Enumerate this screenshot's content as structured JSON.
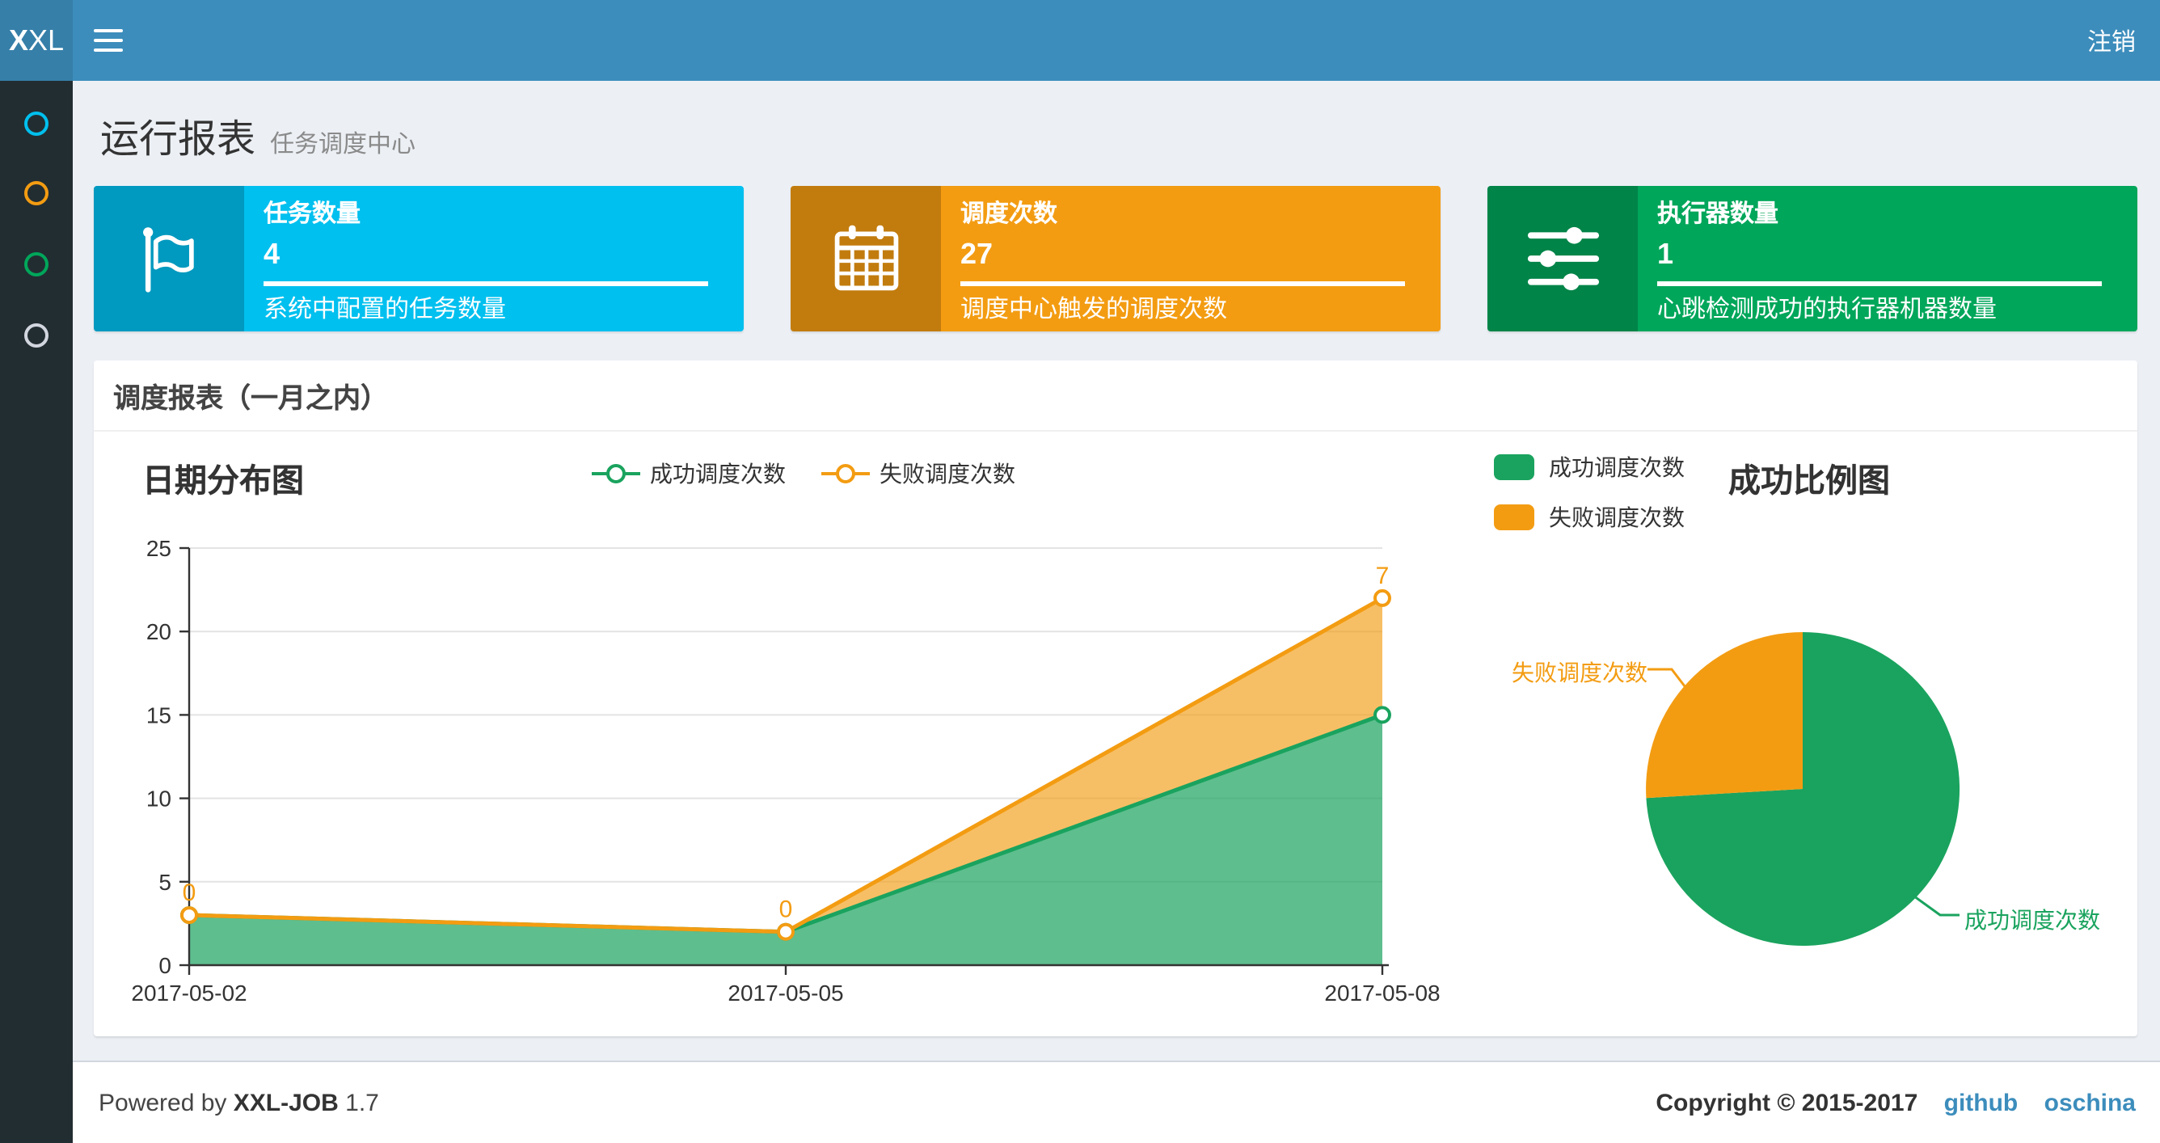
{
  "navbar": {
    "logo_bold": "X",
    "logo_rest": "XL",
    "logout_label": "注销"
  },
  "sidebar": {
    "items": [
      {
        "icon": "circle-icon",
        "color": "#00c0ef"
      },
      {
        "icon": "circle-icon",
        "color": "#f39c12"
      },
      {
        "icon": "circle-icon",
        "color": "#00a65a"
      },
      {
        "icon": "circle-icon",
        "color": "#d2d6de"
      }
    ]
  },
  "page_header": {
    "title": "运行报表",
    "subtitle": "任务调度中心"
  },
  "stat_cards": [
    {
      "icon": "flag-icon",
      "label": "任务数量",
      "value": "4",
      "desc": "系统中配置的任务数量",
      "color": "#00c0ef"
    },
    {
      "icon": "calendar-icon",
      "label": "调度次数",
      "value": "27",
      "desc": "调度中心触发的调度次数",
      "color": "#f39c12"
    },
    {
      "icon": "sliders-icon",
      "label": "执行器数量",
      "value": "1",
      "desc": "心跳检测成功的执行器机器数量",
      "color": "#00a65a"
    }
  ],
  "report_panel": {
    "title": "调度报表（一月之内）"
  },
  "chart_data": [
    {
      "type": "area",
      "title": "日期分布图",
      "categories": [
        "2017-05-02",
        "2017-05-05",
        "2017-05-08"
      ],
      "stacked": true,
      "series": [
        {
          "name": "成功调度次数",
          "values": [
            3,
            2,
            15
          ],
          "color": "#1aa35e",
          "fill": "rgba(26,163,94,0.7)"
        },
        {
          "name": "失败调度次数",
          "values": [
            0,
            0,
            7
          ],
          "color": "#f39c12",
          "fill": "rgba(243,156,18,0.65)",
          "data_labels": [
            "0",
            "0",
            "7"
          ]
        }
      ],
      "ylim": [
        0,
        25
      ],
      "ytick_step": 5,
      "grid": true,
      "legend_position": "top-center"
    },
    {
      "type": "pie",
      "title": "成功比例图",
      "slices": [
        {
          "name": "成功调度次数",
          "value": 20,
          "color": "#1aa35e"
        },
        {
          "name": "失败调度次数",
          "value": 7,
          "color": "#f39c12"
        }
      ],
      "legend_position": "top-left",
      "label_position": "outside"
    }
  ],
  "footer": {
    "powered_prefix": "Powered by",
    "product": "XXL-JOB",
    "version": "1.7",
    "copyright": "Copyright © 2015-2017",
    "links": [
      "github",
      "oschina"
    ]
  }
}
